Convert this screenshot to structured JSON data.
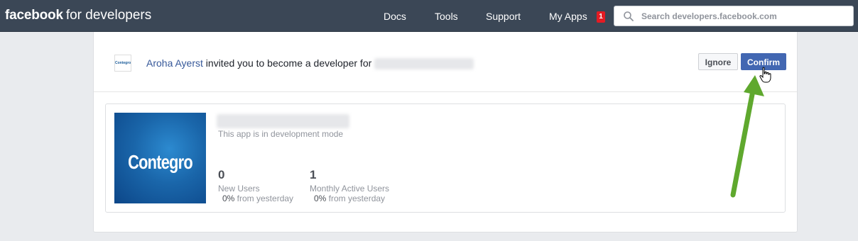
{
  "header": {
    "brand_bold": "facebook",
    "brand_rest": "for developers",
    "nav": [
      "Docs",
      "Tools",
      "Support",
      "My Apps"
    ],
    "my_apps_badge": "1",
    "search_placeholder": "Search developers.facebook.com"
  },
  "invite": {
    "logo_text": "Contegro",
    "inviter": "Aroha Ayerst",
    "message": " invited you to become a developer for ",
    "ignore_label": "Ignore",
    "confirm_label": "Confirm"
  },
  "app": {
    "image_text": "Contegro",
    "mode": "This app is in development mode",
    "stats": [
      {
        "value": "0",
        "label": "New Users",
        "pct": "0%",
        "change": " from yesterday"
      },
      {
        "value": "1",
        "label": "Monthly Active Users",
        "pct": "0%",
        "change": " from yesterday"
      }
    ]
  },
  "colors": {
    "topbar": "#3b4756",
    "confirm": "#4267b2",
    "link": "#365899",
    "badge": "#e41b23",
    "annotation_arrow": "#5fa82e"
  }
}
